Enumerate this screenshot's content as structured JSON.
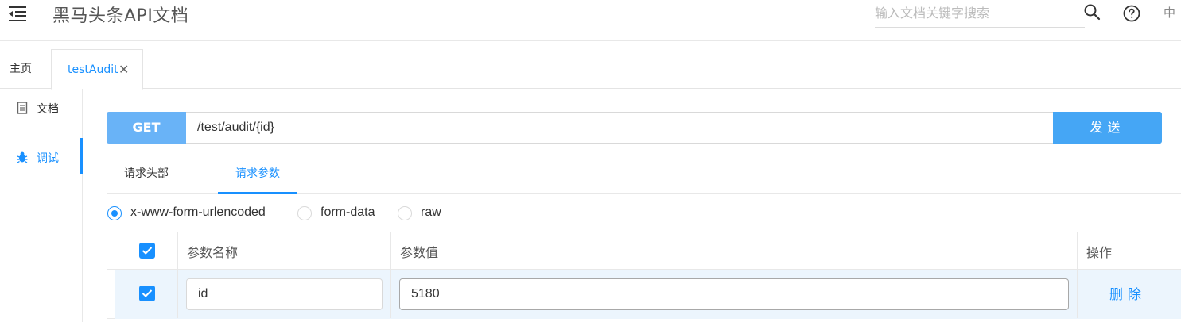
{
  "header": {
    "title": "黑马头条API文档",
    "search_placeholder": "输入文档关键字搜索",
    "lang": "中"
  },
  "tabs": {
    "home": "主页",
    "active": "testAudit",
    "close_glyph": "✕"
  },
  "sidebar": {
    "items": [
      {
        "label": "文档",
        "icon": "document-icon"
      },
      {
        "label": "调试",
        "icon": "bug-icon"
      }
    ]
  },
  "request": {
    "method": "GET",
    "url": "/test/audit/{id}",
    "send_label": "发送"
  },
  "subtabs": {
    "headers": "请求头部",
    "params": "请求参数"
  },
  "body_types": {
    "options": [
      "x-www-form-urlencoded",
      "form-data",
      "raw"
    ],
    "selected": "x-www-form-urlencoded"
  },
  "params_table": {
    "columns": {
      "name": "参数名称",
      "value": "参数值",
      "action": "操作"
    },
    "rows": [
      {
        "checked": true,
        "name": "id",
        "value": "5180",
        "action": "删除"
      }
    ]
  },
  "colors": {
    "accent": "#1890ff",
    "method_bg": "#69b3f7",
    "send_bg": "#45a6f5",
    "row_highlight": "#ecf5fd"
  }
}
